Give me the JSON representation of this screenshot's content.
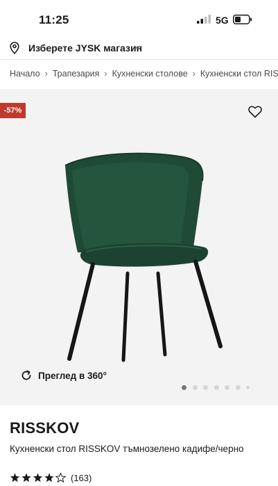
{
  "status_bar": {
    "time": "11:25",
    "network": "5G"
  },
  "store_selector": {
    "label": "Изберете JYSK магазин"
  },
  "breadcrumb": [
    "Начало",
    "Трапезария",
    "Кухненски столове",
    "Кухненски стол RISSKOV"
  ],
  "gallery": {
    "discount_badge": "-57%",
    "view_360_label": "Преглед в 360°",
    "image_count": 7,
    "active_image": 1
  },
  "product": {
    "name": "RISSKOV",
    "description": "Кухненски стол RISSKOV тъмнозелено кадифе/черно",
    "rating_value": 4.5,
    "review_count": "(163)"
  },
  "colors": {
    "discount": "#c0392b",
    "chair_green": "#1f4a36"
  }
}
